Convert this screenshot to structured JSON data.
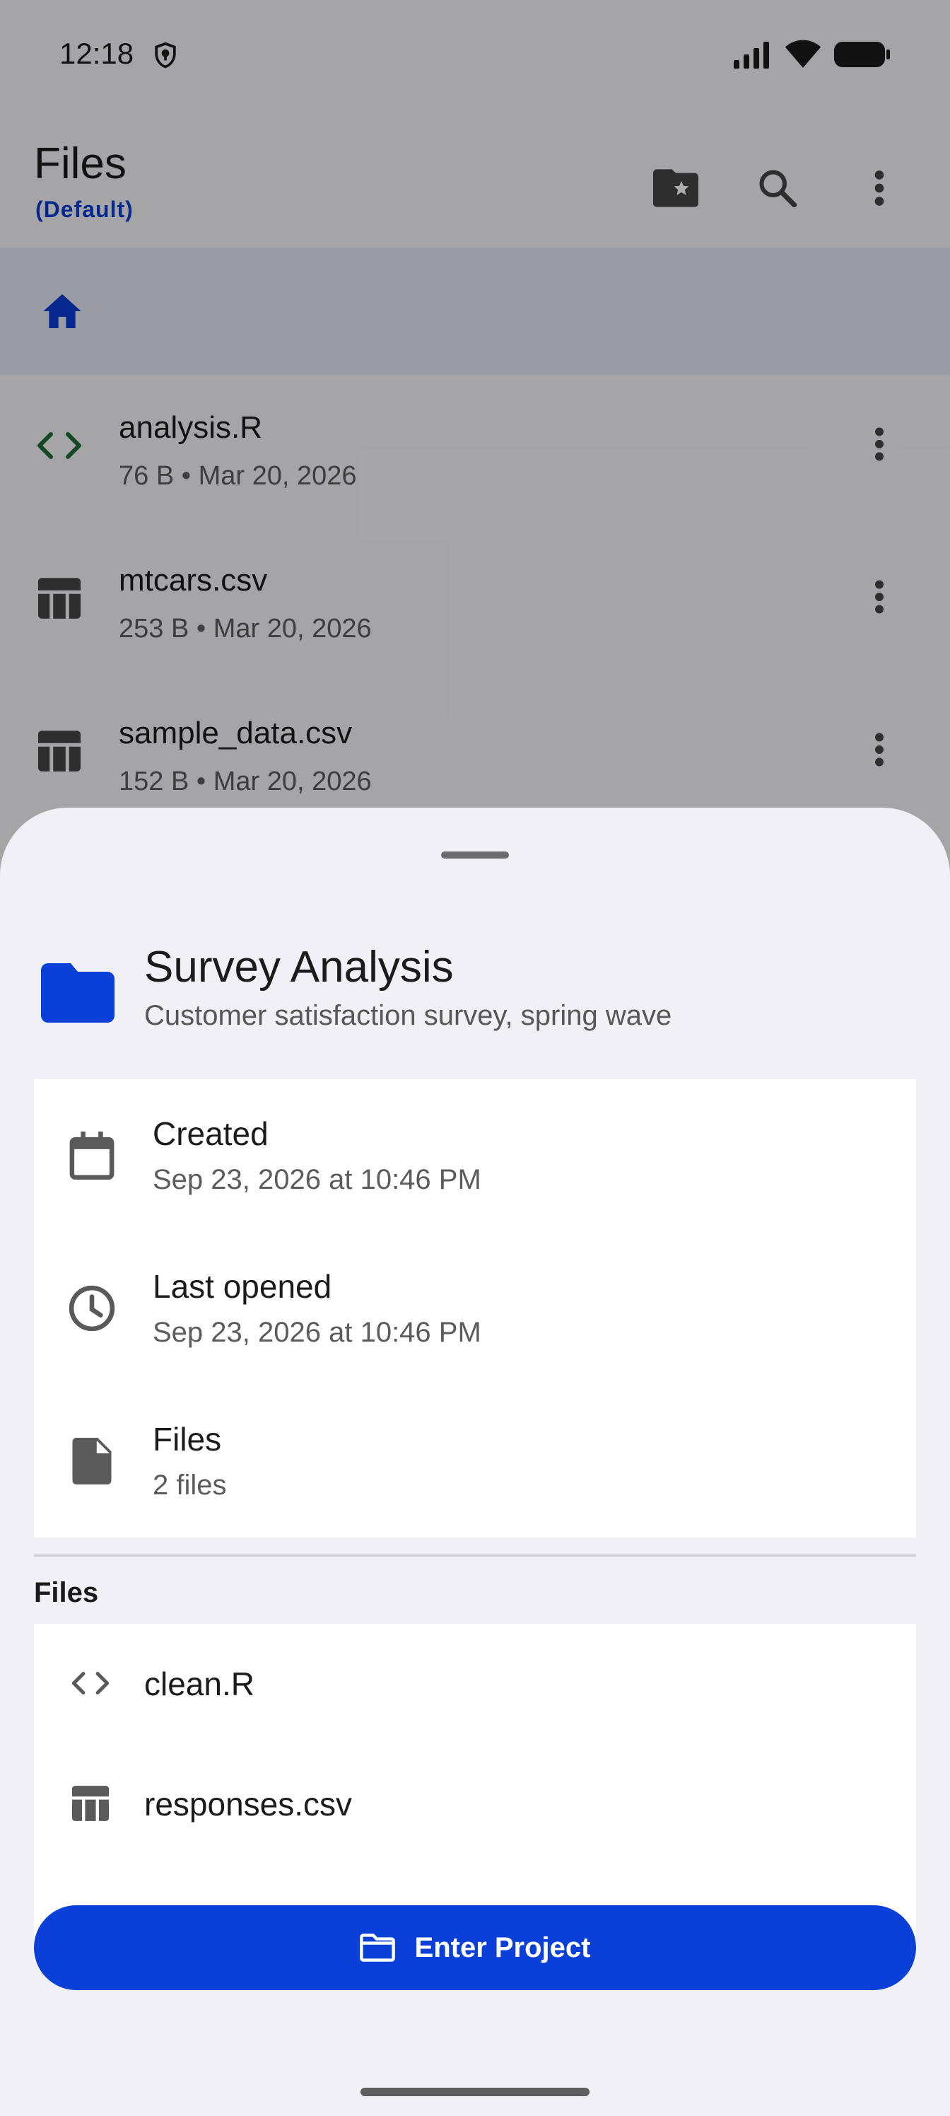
{
  "status_bar": {
    "time": "12:18"
  },
  "app_bar": {
    "title": "Files",
    "subtitle": "(Default)",
    "actions": [
      "favorite-folder-icon",
      "search-icon",
      "more-vert-icon"
    ]
  },
  "breadcrumb": {
    "home_icon": "home-icon"
  },
  "files": [
    {
      "name": "analysis.R",
      "meta": "76 B • Mar 20, 2026",
      "icon": "code-icon"
    },
    {
      "name": "mtcars.csv",
      "meta": "253 B • Mar 20, 2026",
      "icon": "table-icon"
    },
    {
      "name": "sample_data.csv",
      "meta": "152 B • Mar 20, 2026",
      "icon": "table-icon"
    }
  ],
  "sheet": {
    "project_name": "Survey Analysis",
    "project_description": "Customer satisfaction survey, spring wave",
    "info": [
      {
        "label": "Created",
        "value": "Sep 23, 2026 at 10:46 PM",
        "icon": "calendar-icon"
      },
      {
        "label": "Last opened",
        "value": "Sep 23, 2026 at 10:46 PM",
        "icon": "clock-icon"
      },
      {
        "label": "Files",
        "value": "2 files",
        "icon": "file-icon"
      }
    ],
    "files_heading": "Files",
    "project_files": [
      {
        "name": "clean.R",
        "icon": "code-icon"
      },
      {
        "name": "responses.csv",
        "icon": "table-icon"
      }
    ],
    "enter_button_label": "Enter Project"
  },
  "colors": {
    "accent": "#0a40d8",
    "subtitle": "#0b3cd2",
    "code_icon": "#1e6b34"
  }
}
